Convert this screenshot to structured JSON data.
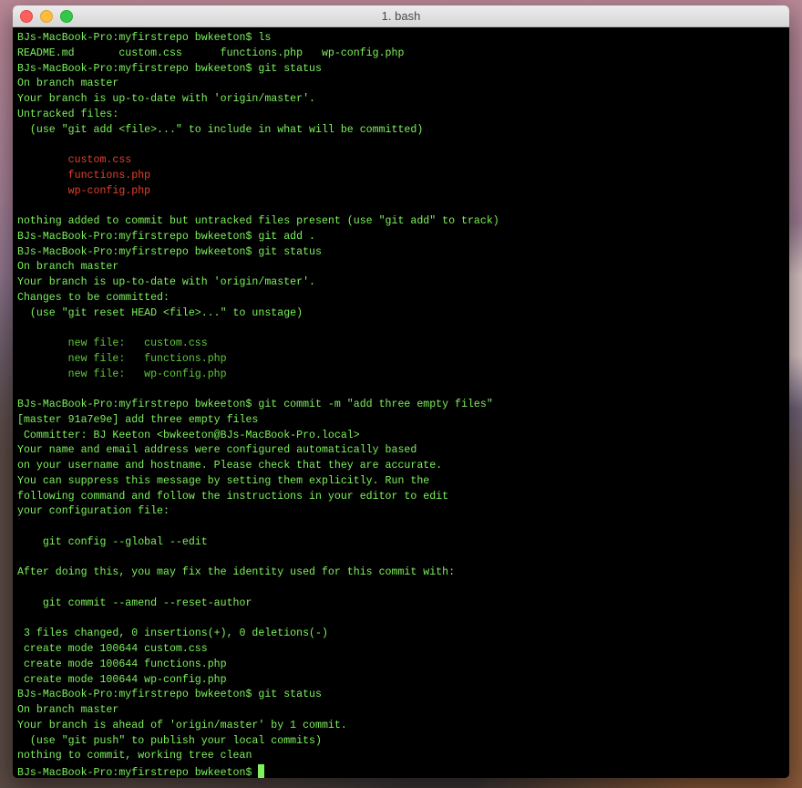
{
  "window": {
    "title": "1. bash"
  },
  "colors": {
    "text": "#7df25c",
    "untracked": "#e2412e",
    "staged": "#5fc83c",
    "background": "#000000"
  },
  "terminal": {
    "lines": [
      {
        "text": "BJs-MacBook-Pro:myfirstrepo bwkeeton$ ls",
        "style": ""
      },
      {
        "text": "README.md       custom.css      functions.php   wp-config.php",
        "style": ""
      },
      {
        "text": "BJs-MacBook-Pro:myfirstrepo bwkeeton$ git status",
        "style": ""
      },
      {
        "text": "On branch master",
        "style": ""
      },
      {
        "text": "Your branch is up-to-date with 'origin/master'.",
        "style": ""
      },
      {
        "text": "Untracked files:",
        "style": ""
      },
      {
        "text": "  (use \"git add <file>...\" to include in what will be committed)",
        "style": ""
      },
      {
        "text": "",
        "style": ""
      },
      {
        "text": "        custom.css",
        "style": "red"
      },
      {
        "text": "        functions.php",
        "style": "red"
      },
      {
        "text": "        wp-config.php",
        "style": "red"
      },
      {
        "text": "",
        "style": ""
      },
      {
        "text": "nothing added to commit but untracked files present (use \"git add\" to track)",
        "style": ""
      },
      {
        "text": "BJs-MacBook-Pro:myfirstrepo bwkeeton$ git add .",
        "style": ""
      },
      {
        "text": "BJs-MacBook-Pro:myfirstrepo bwkeeton$ git status",
        "style": ""
      },
      {
        "text": "On branch master",
        "style": ""
      },
      {
        "text": "Your branch is up-to-date with 'origin/master'.",
        "style": ""
      },
      {
        "text": "Changes to be committed:",
        "style": ""
      },
      {
        "text": "  (use \"git reset HEAD <file>...\" to unstage)",
        "style": ""
      },
      {
        "text": "",
        "style": ""
      },
      {
        "text": "        new file:   custom.css",
        "style": "dg"
      },
      {
        "text": "        new file:   functions.php",
        "style": "dg"
      },
      {
        "text": "        new file:   wp-config.php",
        "style": "dg"
      },
      {
        "text": "",
        "style": ""
      },
      {
        "text": "BJs-MacBook-Pro:myfirstrepo bwkeeton$ git commit -m \"add three empty files\"",
        "style": ""
      },
      {
        "text": "[master 91a7e9e] add three empty files",
        "style": ""
      },
      {
        "text": " Committer: BJ Keeton <bwkeeton@BJs-MacBook-Pro.local>",
        "style": ""
      },
      {
        "text": "Your name and email address were configured automatically based",
        "style": ""
      },
      {
        "text": "on your username and hostname. Please check that they are accurate.",
        "style": ""
      },
      {
        "text": "You can suppress this message by setting them explicitly. Run the",
        "style": ""
      },
      {
        "text": "following command and follow the instructions in your editor to edit",
        "style": ""
      },
      {
        "text": "your configuration file:",
        "style": ""
      },
      {
        "text": "",
        "style": ""
      },
      {
        "text": "    git config --global --edit",
        "style": ""
      },
      {
        "text": "",
        "style": ""
      },
      {
        "text": "After doing this, you may fix the identity used for this commit with:",
        "style": ""
      },
      {
        "text": "",
        "style": ""
      },
      {
        "text": "    git commit --amend --reset-author",
        "style": ""
      },
      {
        "text": "",
        "style": ""
      },
      {
        "text": " 3 files changed, 0 insertions(+), 0 deletions(-)",
        "style": ""
      },
      {
        "text": " create mode 100644 custom.css",
        "style": ""
      },
      {
        "text": " create mode 100644 functions.php",
        "style": ""
      },
      {
        "text": " create mode 100644 wp-config.php",
        "style": ""
      },
      {
        "text": "BJs-MacBook-Pro:myfirstrepo bwkeeton$ git status",
        "style": ""
      },
      {
        "text": "On branch master",
        "style": ""
      },
      {
        "text": "Your branch is ahead of 'origin/master' by 1 commit.",
        "style": ""
      },
      {
        "text": "  (use \"git push\" to publish your local commits)",
        "style": ""
      },
      {
        "text": "nothing to commit, working tree clean",
        "style": ""
      }
    ],
    "prompt": "BJs-MacBook-Pro:myfirstrepo bwkeeton$ "
  }
}
